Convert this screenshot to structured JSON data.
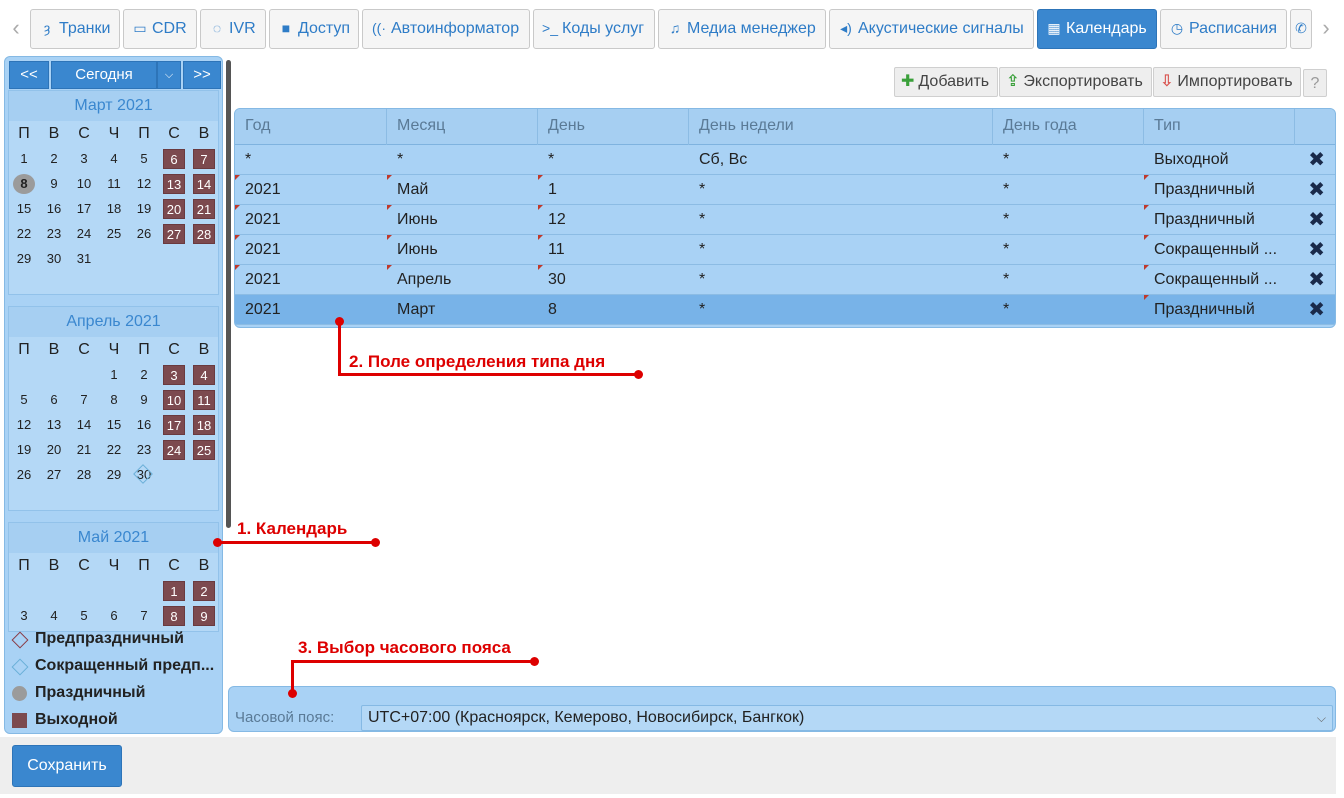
{
  "tabs": [
    {
      "label": "Транки",
      "icon": "trunk-icon"
    },
    {
      "label": "CDR",
      "icon": "card-icon"
    },
    {
      "label": "IVR",
      "icon": "chat-icon"
    },
    {
      "label": "Доступ",
      "icon": "lock-icon"
    },
    {
      "label": "Автоинформатор",
      "icon": "broadcast-icon"
    },
    {
      "label": "Коды услуг",
      "icon": "terminal-icon"
    },
    {
      "label": "Медиа менеджер",
      "icon": "music-note-icon"
    },
    {
      "label": "Акустические сигналы",
      "icon": "volume-icon"
    },
    {
      "label": "Календарь",
      "icon": "calendar-icon",
      "active": true
    },
    {
      "label": "Расписания",
      "icon": "clock-icon"
    },
    {
      "label": "",
      "icon": "phone-icon"
    }
  ],
  "calendar": {
    "prev_label": "<<",
    "today_label": "Сегодня",
    "next_label": ">>",
    "weekdays": [
      "П",
      "В",
      "С",
      "Ч",
      "П",
      "С",
      "В"
    ],
    "months": [
      {
        "title": "Март 2021"
      },
      {
        "title": "Апрель 2021"
      },
      {
        "title": "Май 2021"
      }
    ]
  },
  "legend": [
    {
      "label": "Предпраздничный",
      "symbol": "diamond-red"
    },
    {
      "label": "Сокращенный предп...",
      "symbol": "diamond-blue"
    },
    {
      "label": "Праздничный",
      "symbol": "circle-gray"
    },
    {
      "label": "Выходной",
      "symbol": "square-brown"
    }
  ],
  "toolbar": {
    "add_label": "Добавить",
    "export_label": "Экспортировать",
    "import_label": "Импортировать",
    "help_label": "?"
  },
  "table": {
    "columns": [
      "Год",
      "Месяц",
      "День",
      "День недели",
      "День года",
      "Тип"
    ],
    "rows": [
      {
        "year": "*",
        "month": "*",
        "day": "*",
        "weekday": "Сб, Вс",
        "yearday": "*",
        "type": "Выходной"
      },
      {
        "year": "2021",
        "month": "Май",
        "day": "1",
        "weekday": "*",
        "yearday": "*",
        "type": "Праздничный"
      },
      {
        "year": "2021",
        "month": "Июнь",
        "day": "12",
        "weekday": "*",
        "yearday": "*",
        "type": "Праздничный"
      },
      {
        "year": "2021",
        "month": "Июнь",
        "day": "11",
        "weekday": "*",
        "yearday": "*",
        "type": "Сокращенный ..."
      },
      {
        "year": "2021",
        "month": "Апрель",
        "day": "30",
        "weekday": "*",
        "yearday": "*",
        "type": "Сокращенный ..."
      },
      {
        "year": "2021",
        "month": "Март",
        "day": "8",
        "weekday": "*",
        "yearday": "*",
        "type": "Праздничный",
        "selected": true
      }
    ]
  },
  "timezone": {
    "label": "Часовой пояс:",
    "value": "UTC+07:00 (Красноярск, Кемерово, Новосибирск, Бангкок)"
  },
  "footer": {
    "save_label": "Сохранить"
  },
  "annotations": {
    "calendar": "1. Календарь",
    "day_type": "2. Поле определения типа дня",
    "timezone": "3. Выбор часового пояса"
  },
  "colors": {
    "accent": "#3a87cf",
    "panel": "#a9d2f5",
    "weekend": "#7c4a4f",
    "holiday": "#9b9b9b",
    "annotation": "#dd0000"
  }
}
